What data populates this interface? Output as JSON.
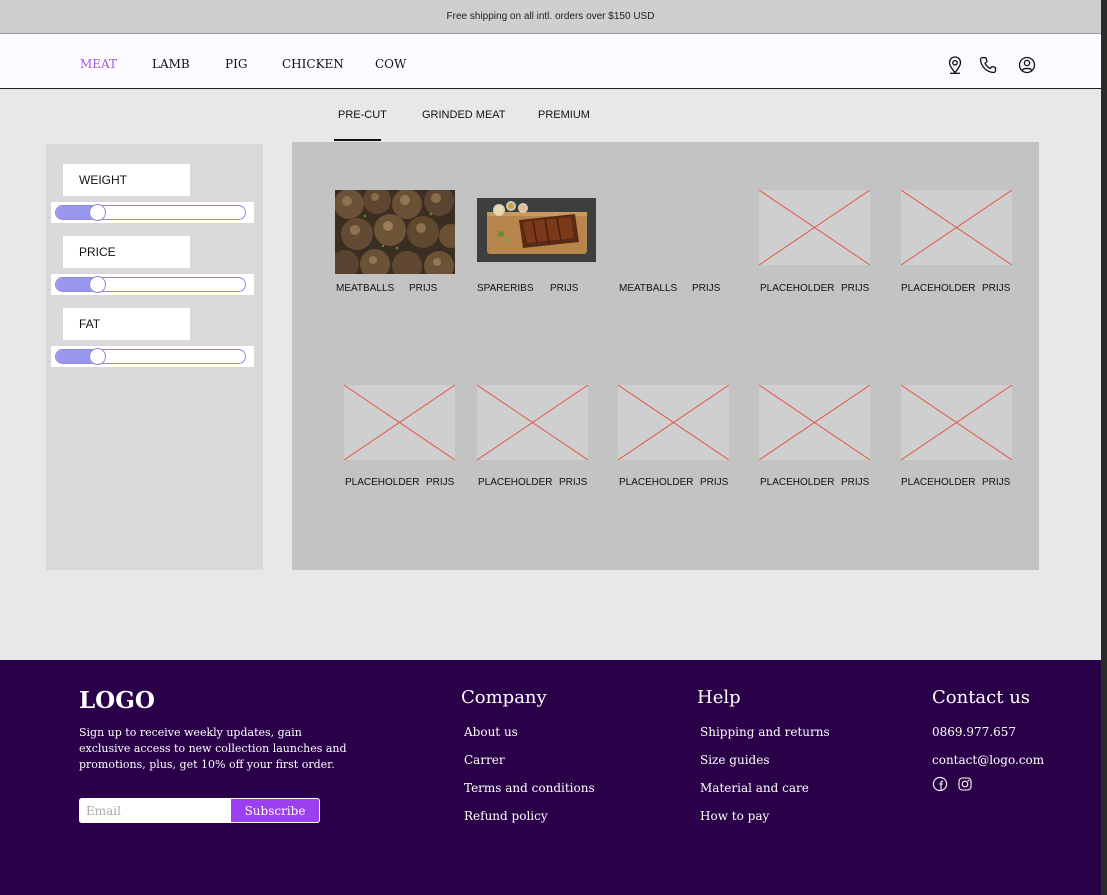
{
  "topbar": {
    "text": "Free shipping on all intl. orders over $150 USD"
  },
  "nav": {
    "items": [
      {
        "label": "MEAT",
        "active": true
      },
      {
        "label": "LAMB"
      },
      {
        "label": "PIG"
      },
      {
        "label": "CHICKEN"
      },
      {
        "label": "COW"
      }
    ],
    "icons": [
      "location-pin-icon",
      "phone-icon",
      "user-account-icon"
    ],
    "active_color": "#a05bd9"
  },
  "tabs": [
    {
      "label": "PRE-CUT",
      "active": true
    },
    {
      "label": "GRINDED MEAT"
    },
    {
      "label": "PREMIUM"
    }
  ],
  "filters": [
    {
      "label": "WEIGHT",
      "value_fraction": 0.22
    },
    {
      "label": "PRICE",
      "value_fraction": 0.22
    },
    {
      "label": "FAT",
      "value_fraction": 0.22
    }
  ],
  "products": {
    "row1": [
      {
        "name": "MEATBALLS",
        "price": "PRIJS",
        "image": "meatballs-photo"
      },
      {
        "name": "SPARERIBS",
        "price": "PRIJS",
        "image": "spareribs-photo"
      },
      {
        "name": "MEATBALLS",
        "price": "PRIJS",
        "image": "none"
      },
      {
        "name": "PLACEHOLDER",
        "price": "PRIJS",
        "image": "placeholder"
      },
      {
        "name": "PLACEHOLDER",
        "price": "PRIJS",
        "image": "placeholder"
      }
    ],
    "row2": [
      {
        "name": "PLACEHOLDER",
        "price": "PRIJS",
        "image": "placeholder"
      },
      {
        "name": "PLACEHOLDER",
        "price": "PRIJS",
        "image": "placeholder"
      },
      {
        "name": "PLACEHOLDER",
        "price": "PRIJS",
        "image": "placeholder"
      },
      {
        "name": "PLACEHOLDER",
        "price": "PRIJS",
        "image": "placeholder"
      },
      {
        "name": "PLACEHOLDER",
        "price": "PRIJS",
        "image": "placeholder"
      }
    ]
  },
  "footer": {
    "logo": "LOGO",
    "blurb": "Sign up to receive weekly updates, gain exclusive access to new collection launches and promotions, plus, get 10% off your first order.",
    "email_placeholder": "Email",
    "subscribe_label": "Subscribe",
    "company": {
      "heading": "Company",
      "links": [
        "About us",
        "Carrer",
        "Terms and conditions",
        "Refund policy"
      ]
    },
    "help": {
      "heading": "Help",
      "links": [
        "Shipping and returns",
        "Size guides",
        "Material and care",
        "How to pay"
      ]
    },
    "contact": {
      "heading": "Contact us",
      "phone": "0869.977.657",
      "email": "contact@logo.com",
      "social_icons": [
        "facebook-icon",
        "instagram-icon"
      ]
    },
    "bg_color": "#2a0049",
    "accent_color": "#9c3ff0"
  }
}
